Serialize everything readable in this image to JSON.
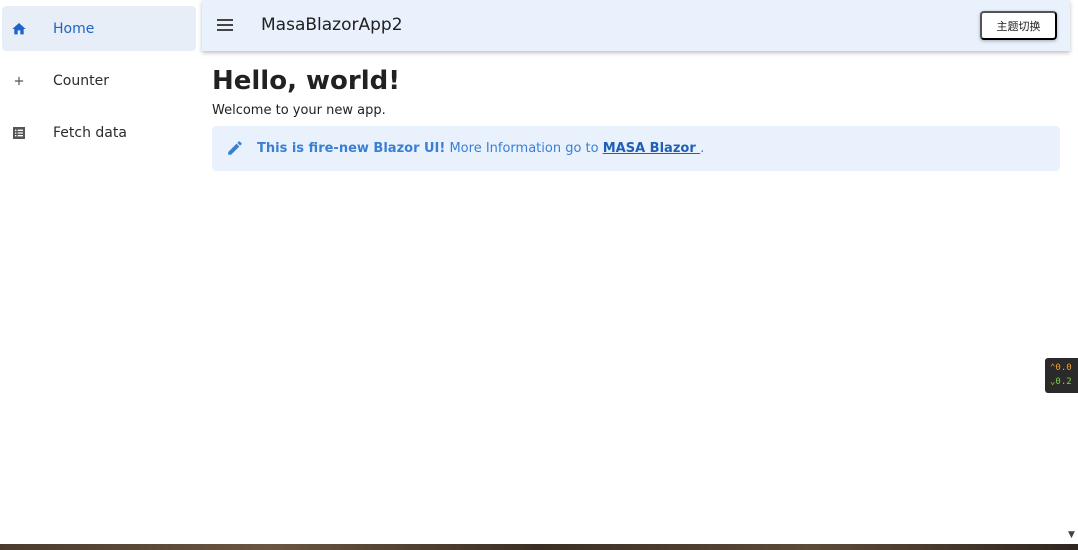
{
  "sidebar": {
    "items": [
      {
        "label": "Home",
        "icon": "home-icon",
        "active": true
      },
      {
        "label": "Counter",
        "icon": "plus-icon",
        "active": false
      },
      {
        "label": "Fetch data",
        "icon": "list-icon",
        "active": false
      }
    ]
  },
  "appbar": {
    "title": "MasaBlazorApp2",
    "theme_button": "主题切换"
  },
  "main": {
    "title": "Hello, world!",
    "subtitle": "Welcome to your new app.",
    "alert": {
      "bold": "This is fire-new Blazor UI!",
      "text": " More Information go to ",
      "link": "MASA Blazor ",
      "suffix": "."
    }
  },
  "widget": {
    "up": "0.0",
    "down": "0.2"
  },
  "colors": {
    "accent": "#1e63c9",
    "appbar_bg": "#e8f1fc",
    "alert_bg": "#e9f2fc"
  }
}
